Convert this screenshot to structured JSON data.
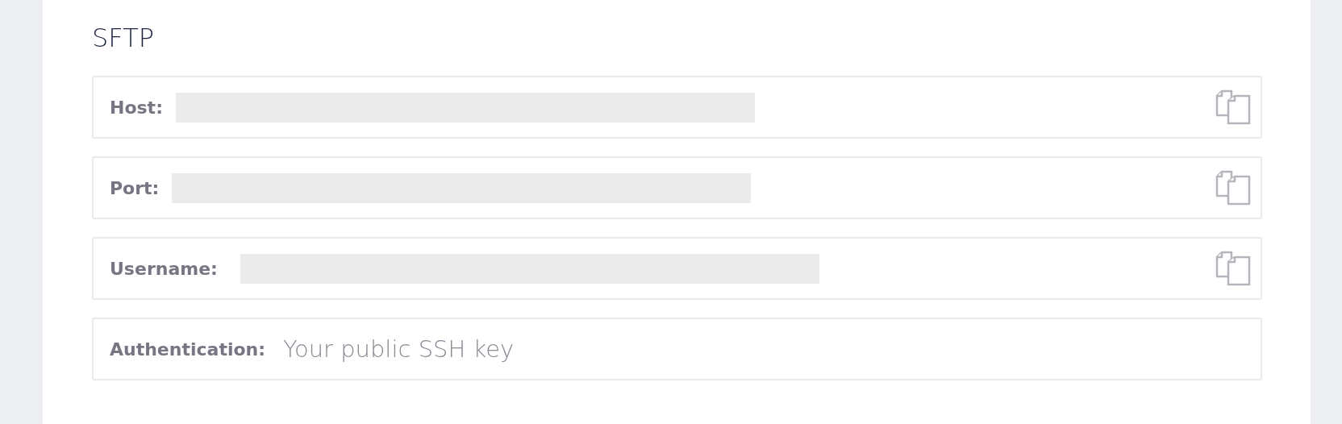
{
  "section": {
    "title": "SFTP"
  },
  "fields": [
    {
      "kind": "redacted",
      "label": "Host:",
      "redacted": true,
      "copy": true
    },
    {
      "kind": "redacted",
      "label": "Port:",
      "redacted": true,
      "copy": true
    },
    {
      "kind": "redacted",
      "label": "Username:",
      "redacted": true,
      "copy": true
    },
    {
      "kind": "text",
      "label": "Authentication:",
      "placeholder": "Your public SSH key",
      "copy": false
    }
  ]
}
